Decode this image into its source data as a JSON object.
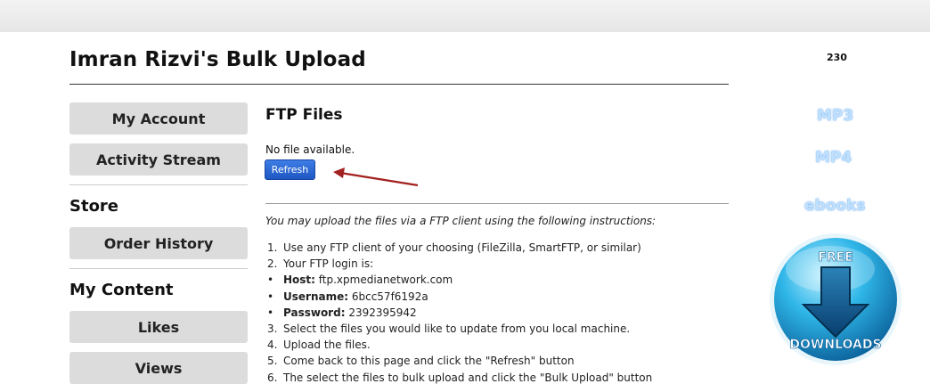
{
  "header": {
    "title": "Imran Rizvi's Bulk Upload",
    "count": "230"
  },
  "sidebar": {
    "my_account": "My Account",
    "activity_stream": "Activity Stream",
    "store_heading": "Store",
    "order_history": "Order History",
    "my_content_heading": "My Content",
    "likes": "Likes",
    "views": "Views"
  },
  "main": {
    "heading": "FTP Files",
    "status": "No file available.",
    "refresh_label": "Refresh",
    "instructions_intro": "You may upload the files via a FTP client using the following instructions:",
    "steps": [
      {
        "marker": "1.",
        "label": "",
        "value": "Use any FTP client of your choosing (FileZilla, SmartFTP, or similar)"
      },
      {
        "marker": "2.",
        "label": "",
        "value": "Your FTP login is:"
      },
      {
        "marker": "•",
        "label": "Host:",
        "value": " ftp.xpmedianetwork.com"
      },
      {
        "marker": "•",
        "label": "Username:",
        "value": " 6bcc57f6192a"
      },
      {
        "marker": "•",
        "label": "Password:",
        "value": " 2392395942"
      },
      {
        "marker": "3.",
        "label": "",
        "value": "Select the files you would like to update from you local machine."
      },
      {
        "marker": "4.",
        "label": "",
        "value": "Upload the files."
      },
      {
        "marker": "5.",
        "label": "",
        "value": "Come back to this page and click the \"Refresh\" button"
      },
      {
        "marker": "6.",
        "label": "",
        "value": "The select the files to bulk upload and click the \"Bulk Upload\" button"
      }
    ]
  },
  "right": {
    "formats": [
      "MP3",
      "MP4",
      "ebooks"
    ],
    "badge_top": "FREE",
    "badge_bottom": "DOWNLOADS"
  },
  "colors": {
    "button_blue": "#2563d4",
    "arrow_red": "#a32020",
    "badge_blue": "#1a8fc8"
  }
}
